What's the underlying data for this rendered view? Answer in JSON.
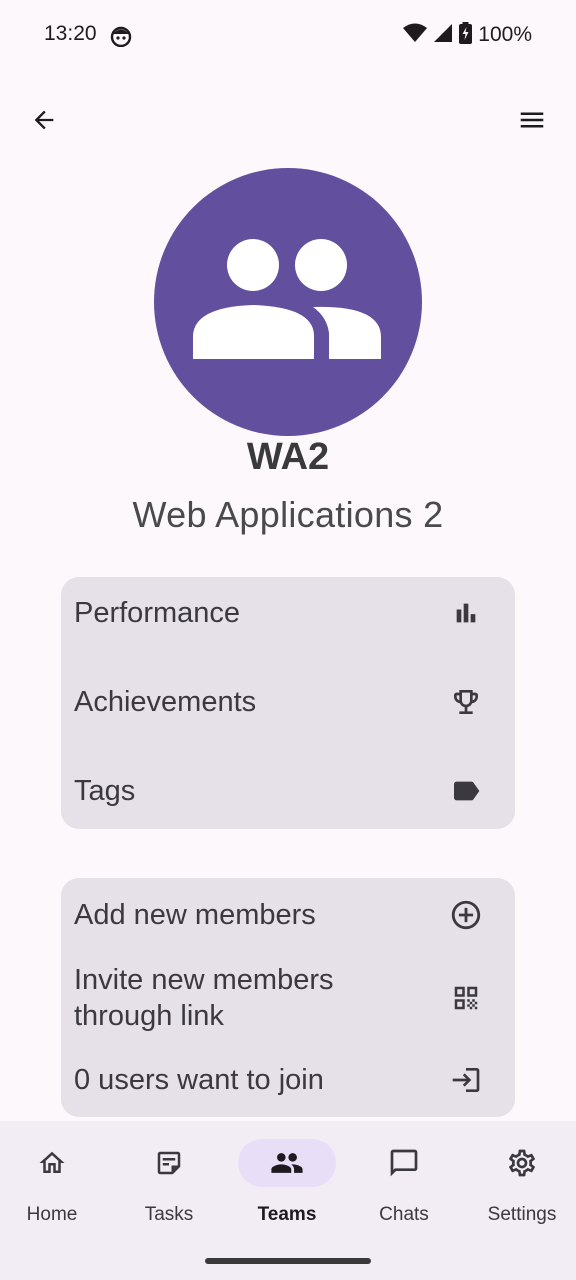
{
  "status_bar": {
    "time": "13:20",
    "battery": "100%"
  },
  "team": {
    "short_name": "WA2",
    "full_name": "Web Applications 2",
    "avatar_color": "#624f9e"
  },
  "stats_menu": [
    {
      "label": "Performance",
      "icon": "bar-chart-icon"
    },
    {
      "label": "Achievements",
      "icon": "trophy-icon"
    },
    {
      "label": "Tags",
      "icon": "tag-icon"
    }
  ],
  "members_menu": [
    {
      "label": "Add new members",
      "icon": "add-circle-icon"
    },
    {
      "label": "Invite new members through link",
      "icon": "qr-code-icon"
    },
    {
      "label": "0 users want to join",
      "icon": "login-icon"
    }
  ],
  "bottom_nav": [
    {
      "label": "Home",
      "icon": "home-icon",
      "active": false
    },
    {
      "label": "Tasks",
      "icon": "tasks-icon",
      "active": false
    },
    {
      "label": "Teams",
      "icon": "groups-icon",
      "active": true
    },
    {
      "label": "Chats",
      "icon": "chat-icon",
      "active": false
    },
    {
      "label": "Settings",
      "icon": "gear-icon",
      "active": false
    }
  ],
  "colors": {
    "background": "#fdf8fc",
    "card": "#e6e0e9",
    "nav_background": "#f2ecf4",
    "active_pill": "#e8def8"
  }
}
